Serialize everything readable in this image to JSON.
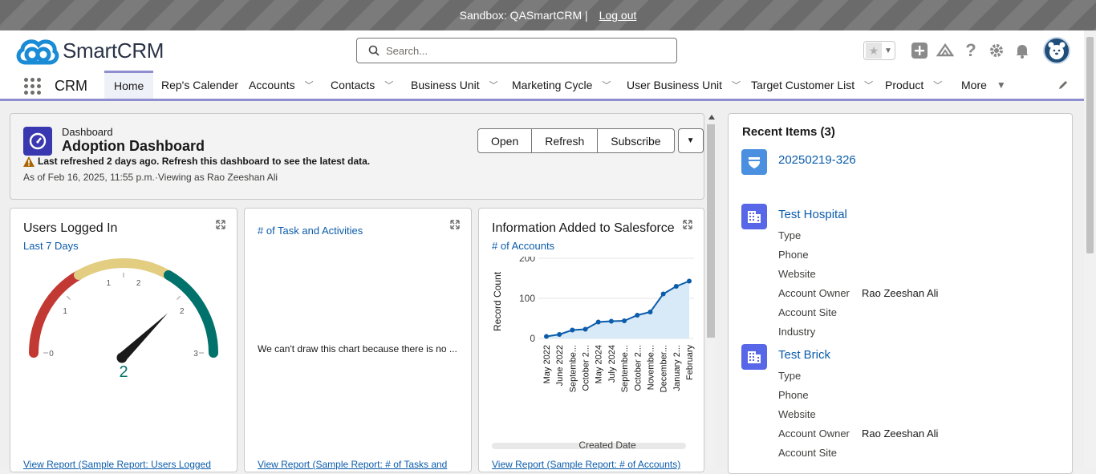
{
  "sandbox": {
    "text": "Sandbox: QASmartCRM |",
    "logout": "Log out"
  },
  "header": {
    "logo_text": "SmartCRM",
    "search_placeholder": "Search..."
  },
  "nav": {
    "app_name": "CRM",
    "items": [
      {
        "label": "Home",
        "active": true
      },
      {
        "label": "Rep's Calender"
      },
      {
        "label": "Accounts"
      },
      {
        "label": "Contacts"
      },
      {
        "label": "Business Unit"
      },
      {
        "label": "Marketing Cycle"
      },
      {
        "label": "User Business Unit"
      },
      {
        "label": "Target Customer List"
      },
      {
        "label": "Product"
      },
      {
        "label": "More"
      }
    ]
  },
  "dashboard": {
    "label": "Dashboard",
    "title": "Adoption Dashboard",
    "warning": "Last refreshed 2 days ago. Refresh this dashboard to see the latest data.",
    "as_of": "As of Feb 16, 2025, 11:55 p.m.·Viewing as Rao Zeeshan Ali",
    "buttons": {
      "open": "Open",
      "refresh": "Refresh",
      "subscribe": "Subscribe"
    }
  },
  "cards": [
    {
      "title": "Users Logged In",
      "subtitle": "Last 7 Days",
      "gauge": {
        "value": "2",
        "ticks": [
          "0",
          "1",
          "1",
          "2",
          "2",
          "3"
        ],
        "min": 0,
        "max": 3,
        "reading": 2,
        "segment_colors": [
          "#c23934",
          "#e2cd81",
          "#00716b"
        ]
      },
      "footer": "View Report (Sample Report: Users Logged"
    },
    {
      "title": "",
      "subtitle": "# of Task and Activities",
      "message": "We can't draw this chart because there is no ...",
      "footer": "View Report (Sample Report: # of Tasks and"
    },
    {
      "title": "Information Added to Salesforce",
      "subtitle": "# of Accounts",
      "footer": "View Report (Sample Report: # of Accounts)"
    }
  ],
  "chart_data": {
    "type": "area",
    "title": "Information Added to Salesforce",
    "xlabel": "Created Date",
    "ylabel": "Record Count",
    "ylim": [
      0,
      200
    ],
    "yticks": [
      "0",
      "100",
      "200"
    ],
    "categories": [
      "May 2022",
      "June 2022",
      "Septembe...",
      "October 2...",
      "May 2024",
      "July 2024",
      "Septembe...",
      "October 2...",
      "Novembe...",
      "December...",
      "January 2...",
      "February"
    ],
    "values": [
      5,
      10,
      21,
      23,
      41,
      43,
      44,
      58,
      66,
      111,
      130,
      143
    ],
    "color": "#0b5cab",
    "fill": "#d8e9f7"
  },
  "recent": {
    "title": "Recent Items (3)",
    "items": [
      {
        "name": "20250219-326",
        "icon": "shield-icon"
      },
      {
        "name": "Test Hospital",
        "icon": "building-icon",
        "fields": [
          "Type",
          "Phone",
          "Website",
          "Account Owner",
          "Account Site",
          "Industry"
        ],
        "owner": "Rao Zeeshan Ali"
      },
      {
        "name": "Test Brick",
        "icon": "building-icon",
        "fields": [
          "Type",
          "Phone",
          "Website",
          "Account Owner",
          "Account Site"
        ],
        "owner": "Rao Zeeshan Ali"
      }
    ]
  }
}
